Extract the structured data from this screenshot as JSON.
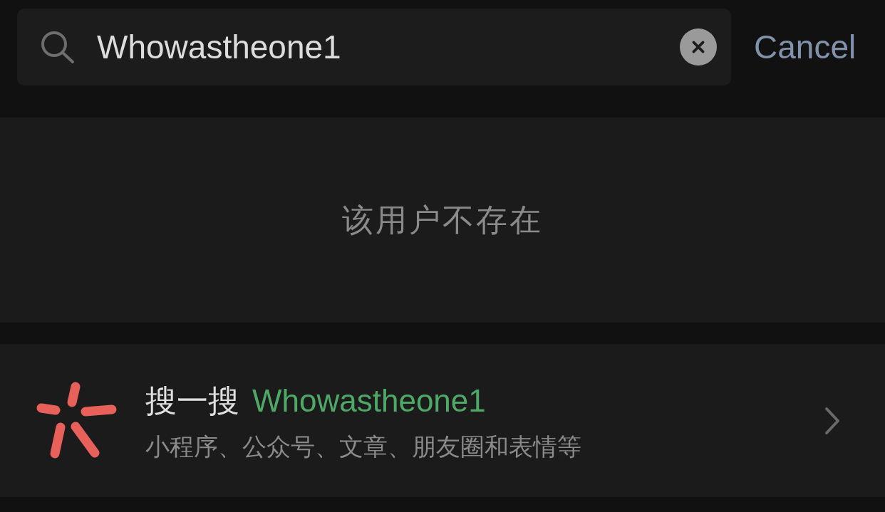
{
  "search": {
    "value": "Whowastheone1",
    "cancel": "Cancel"
  },
  "result": {
    "message": "该用户不存在"
  },
  "web_search": {
    "title": "搜一搜",
    "query": "Whowastheone1",
    "subtitle": "小程序、公众号、文章、朋友圈和表情等"
  }
}
